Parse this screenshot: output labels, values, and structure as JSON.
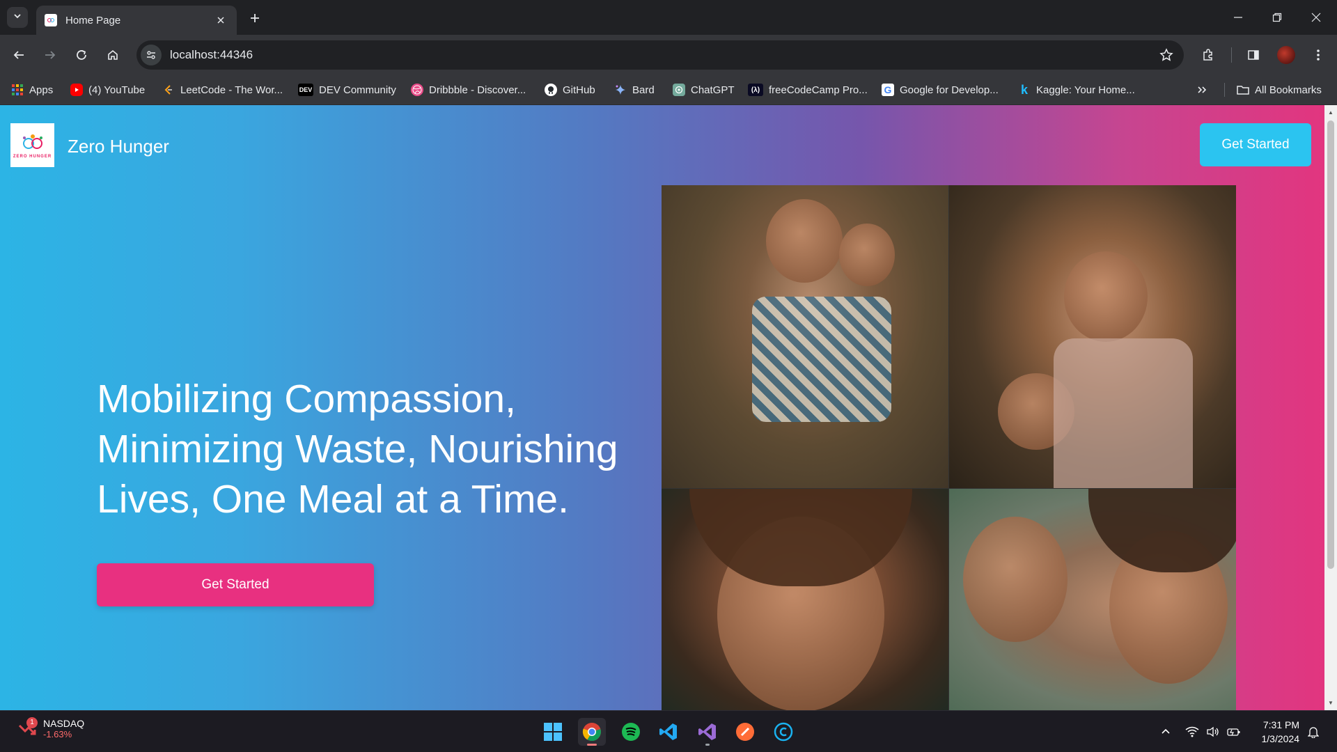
{
  "browser": {
    "tab_title": "Home Page",
    "url": "localhost:44346",
    "bookmarks": [
      {
        "label": "Apps",
        "icon": "apps-grid-icon"
      },
      {
        "label": "(4) YouTube",
        "icon": "youtube-icon"
      },
      {
        "label": "LeetCode - The Wor...",
        "icon": "leetcode-icon"
      },
      {
        "label": "DEV Community",
        "icon": "dev-icon"
      },
      {
        "label": "Dribbble - Discover...",
        "icon": "dribbble-icon"
      },
      {
        "label": "GitHub",
        "icon": "github-icon"
      },
      {
        "label": "Bard",
        "icon": "bard-icon"
      },
      {
        "label": "ChatGPT",
        "icon": "chatgpt-icon"
      },
      {
        "label": "freeCodeCamp Pro...",
        "icon": "freecodecamp-icon"
      },
      {
        "label": "Google for Develop...",
        "icon": "google-icon"
      },
      {
        "label": "Kaggle: Your Home...",
        "icon": "kaggle-icon"
      }
    ],
    "all_bookmarks_label": "All Bookmarks",
    "dev_icon_text": "DEV",
    "fcc_icon_text": "(λ)",
    "google_icon_text": "G",
    "kaggle_icon_text": "k"
  },
  "site": {
    "logo_text": "ZERO HUNGER",
    "name": "Zero Hunger",
    "nav_cta": "Get Started",
    "hero_title": "Mobilizing Compassion, Minimizing Waste, Nourishing Lives, One Meal at a Time.",
    "hero_cta": "Get Started",
    "colors": {
      "gradient_start": "#2cb4e5",
      "gradient_mid": "#7656ac",
      "gradient_end": "#e2357f",
      "cta_pink": "#e83080",
      "cta_cyan": "#2bc4f0"
    }
  },
  "taskbar": {
    "widget_name": "NASDAQ",
    "widget_change": "-1.63%",
    "widget_badge": "1",
    "time": "7:31 PM",
    "date": "1/3/2024"
  }
}
